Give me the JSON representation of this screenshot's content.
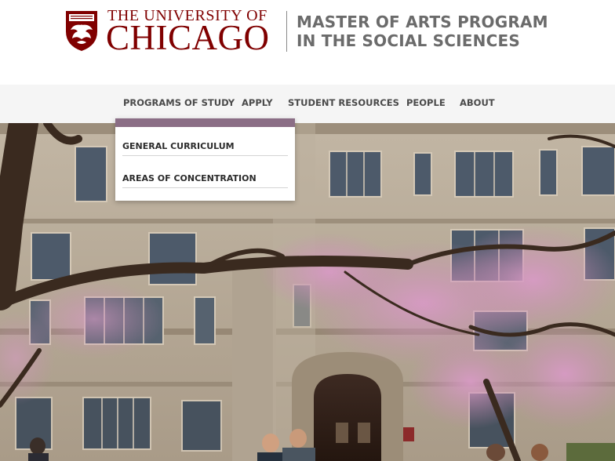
{
  "header": {
    "logo": {
      "line1": "THE UNIVERSITY OF",
      "line2": "CHICAGO",
      "icon": "phoenix-shield-icon",
      "color": "#800000"
    },
    "program": {
      "line1": "MASTER OF ARTS PROGRAM",
      "line2": "IN THE SOCIAL SCIENCES",
      "color": "#6b6b6b"
    }
  },
  "nav": {
    "items": [
      {
        "label": "PROGRAMS OF STUDY"
      },
      {
        "label": "APPLY"
      },
      {
        "label": "STUDENT RESOURCES"
      },
      {
        "label": "PEOPLE"
      },
      {
        "label": "ABOUT"
      }
    ],
    "background": "#f5f5f5"
  },
  "dropdown": {
    "accent": "#8b6e86",
    "items": [
      {
        "label": "GENERAL CURRICULUM"
      },
      {
        "label": "AREAS OF CONCENTRATION"
      }
    ]
  },
  "hero": {
    "image": "campus-gothic-building-photo",
    "colors": {
      "stone": "#b9ad9c",
      "blossom": "#c98bb4",
      "window": "#4d5a6a"
    }
  }
}
